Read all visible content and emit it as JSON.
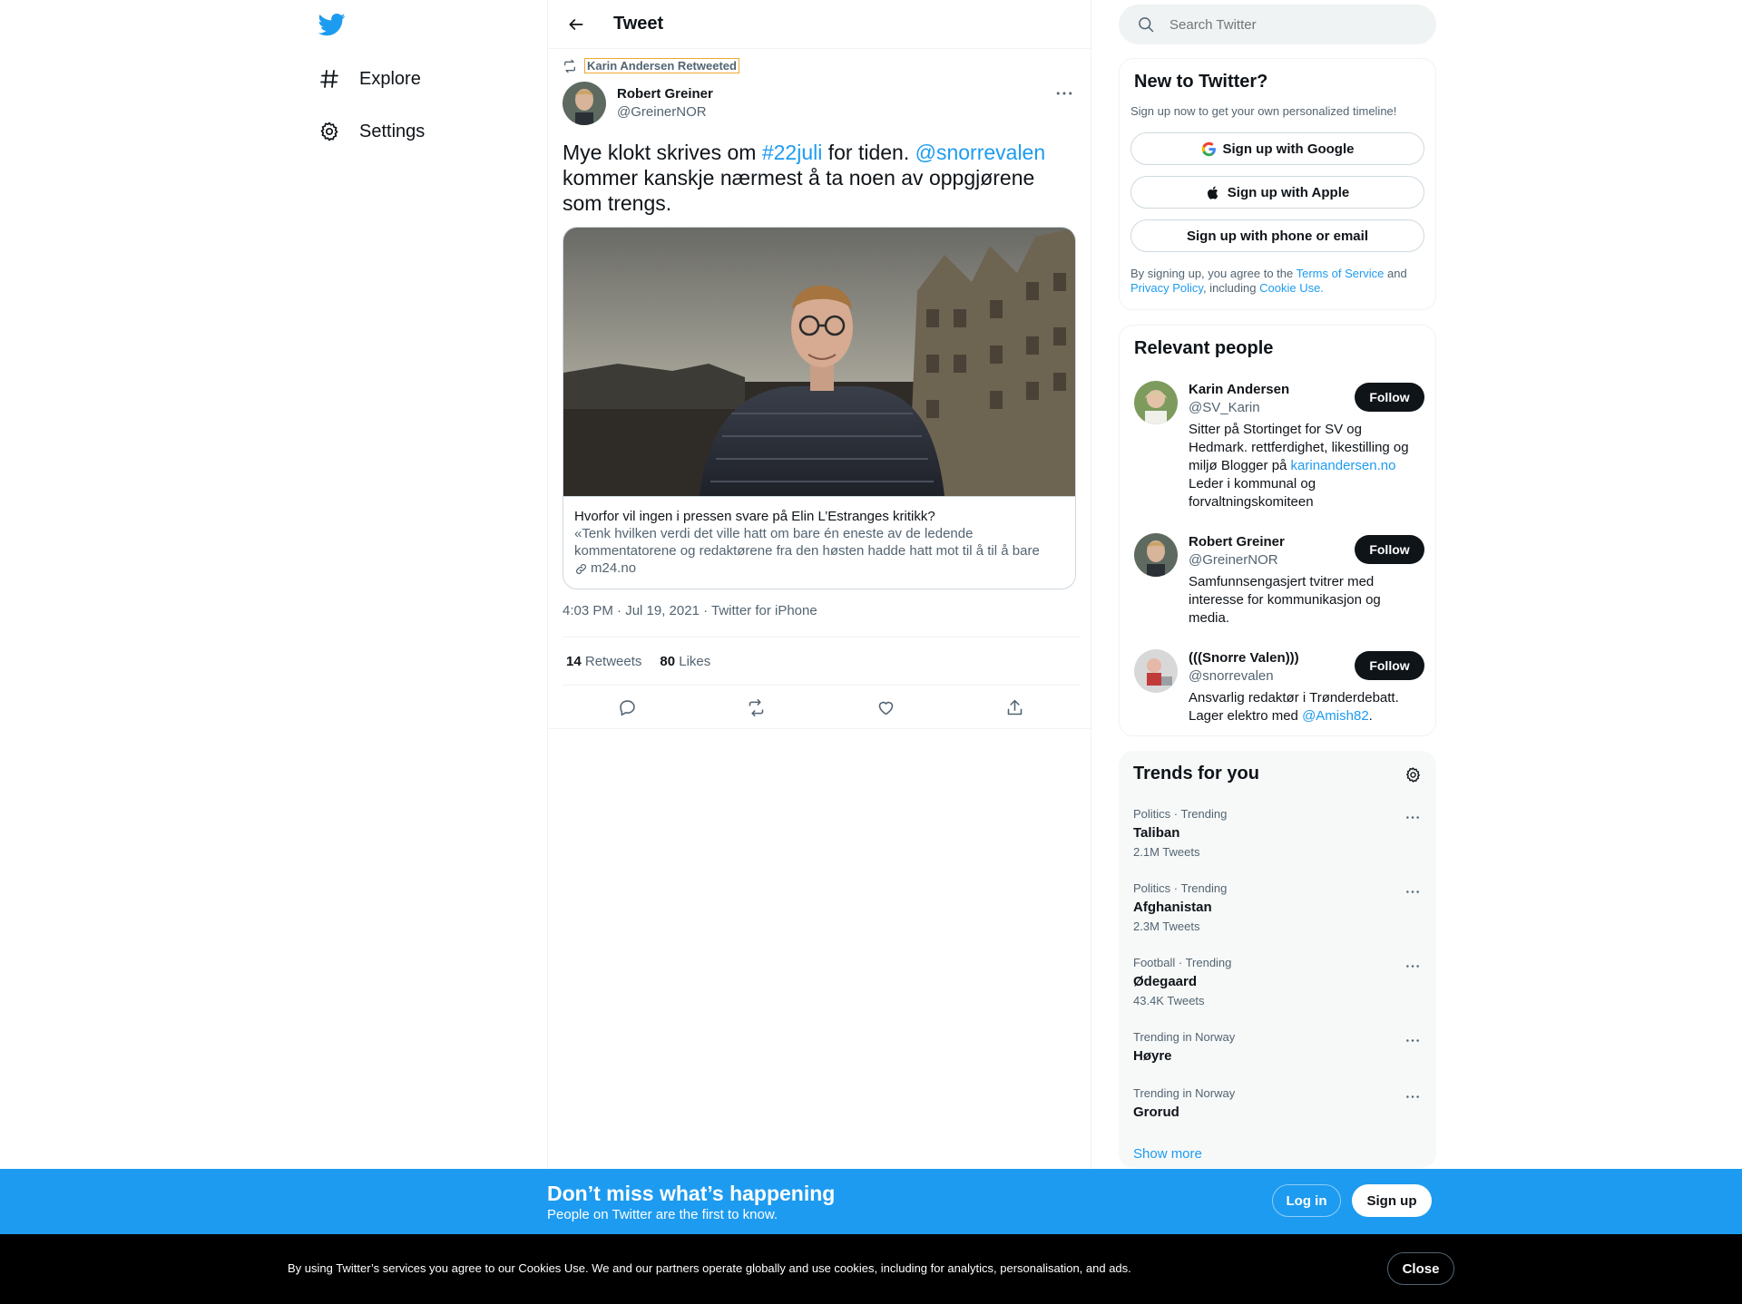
{
  "nav": {
    "logo": "twitter-bird-icon",
    "items": [
      {
        "label": "Explore",
        "icon": "hashtag-icon"
      },
      {
        "label": "Settings",
        "icon": "gear-icon"
      }
    ]
  },
  "header": {
    "title": "Tweet",
    "back_icon": "arrow-left-icon"
  },
  "tweet": {
    "retweeted_by": "Karin Andersen Retweeted",
    "author_name": "Robert Greiner",
    "author_handle": "@GreinerNOR",
    "text_1": "Mye klokt skrives om ",
    "hashtag": "#22juli",
    "text_2": " for tiden. ",
    "mention": "@snorrevalen",
    "text_3": " kommer kanskje nærmest å ta noen av oppgjørene som trengs.",
    "card": {
      "title": "Hvorfor vil ingen i pressen svare på Elin L’Estranges kritikk?",
      "description": "«Tenk hvilken verdi det ville hatt om bare én eneste av de ledende kommentatorene og redaktørene fra den høsten hadde hatt mot til å til å bare si…",
      "domain": "m24.no"
    },
    "timestamp": "4:03 PM · Jul 19, 2021 · Twitter for iPhone",
    "retweets_count": "14",
    "retweets_label": " Retweets",
    "likes_count": "80",
    "likes_label": " Likes"
  },
  "search": {
    "placeholder": "Search Twitter"
  },
  "new_to_twitter": {
    "title": "New to Twitter?",
    "subtitle": "Sign up now to get your own personalized timeline!",
    "google": "Sign up with Google",
    "apple": "Sign up with Apple",
    "phone": "Sign up with phone or email",
    "terms_1": "By signing up, you agree to the ",
    "terms_link": "Terms of Service",
    "terms_2": " and ",
    "privacy_link": "Privacy Policy",
    "terms_3": ", including ",
    "cookie_link": "Cookie Use."
  },
  "relevant_people": {
    "title": "Relevant people",
    "follow_label": "Follow",
    "people": [
      {
        "name": "Karin Andersen",
        "handle": "@SV_Karin",
        "bio_1": "Sitter på Stortinget for SV og Hedmark. rettferdighet, likestilling og miljø Blogger på ",
        "bio_link": "karinandersen.no",
        "bio_2": " Leder i kommunal og forvaltningskomiteen"
      },
      {
        "name": "Robert Greiner",
        "handle": "@GreinerNOR",
        "bio_1": "Samfunnsengasjert tvitrer med interesse for kommunikasjon og media.",
        "bio_link": "",
        "bio_2": ""
      },
      {
        "name": "(((Snorre Valen)))",
        "handle": "@snorrevalen",
        "bio_1": "Ansvarlig redaktør i Trønderdebatt. Lager elektro med ",
        "bio_link": "@Amish82",
        "bio_2": "."
      }
    ]
  },
  "trends": {
    "title": "Trends for you",
    "items": [
      {
        "context": "Politics · Trending",
        "name": "Taliban",
        "count": "2.1M Tweets"
      },
      {
        "context": "Politics · Trending",
        "name": "Afghanistan",
        "count": "2.3M Tweets"
      },
      {
        "context": "Football · Trending",
        "name": "Ødegaard",
        "count": "43.4K Tweets"
      },
      {
        "context": "Trending in Norway",
        "name": "Høyre",
        "count": ""
      },
      {
        "context": "Trending in Norway",
        "name": "Grorud",
        "count": ""
      }
    ],
    "show_more": "Show more"
  },
  "login_bar": {
    "title": "Don’t miss what’s happening",
    "subtitle": "People on Twitter are the first to know.",
    "login": "Log in",
    "signup": "Sign up"
  },
  "cookie_bar": {
    "text": "By using Twitter’s services you agree to our Cookies Use. We and our partners operate globally and use cookies, including for analytics, personalisation, and ads.",
    "close": "Close"
  },
  "colors": {
    "accent": "#1d9bf0",
    "text": "#0f1419",
    "secondary": "#536471",
    "cookie_bg": "#000000"
  }
}
